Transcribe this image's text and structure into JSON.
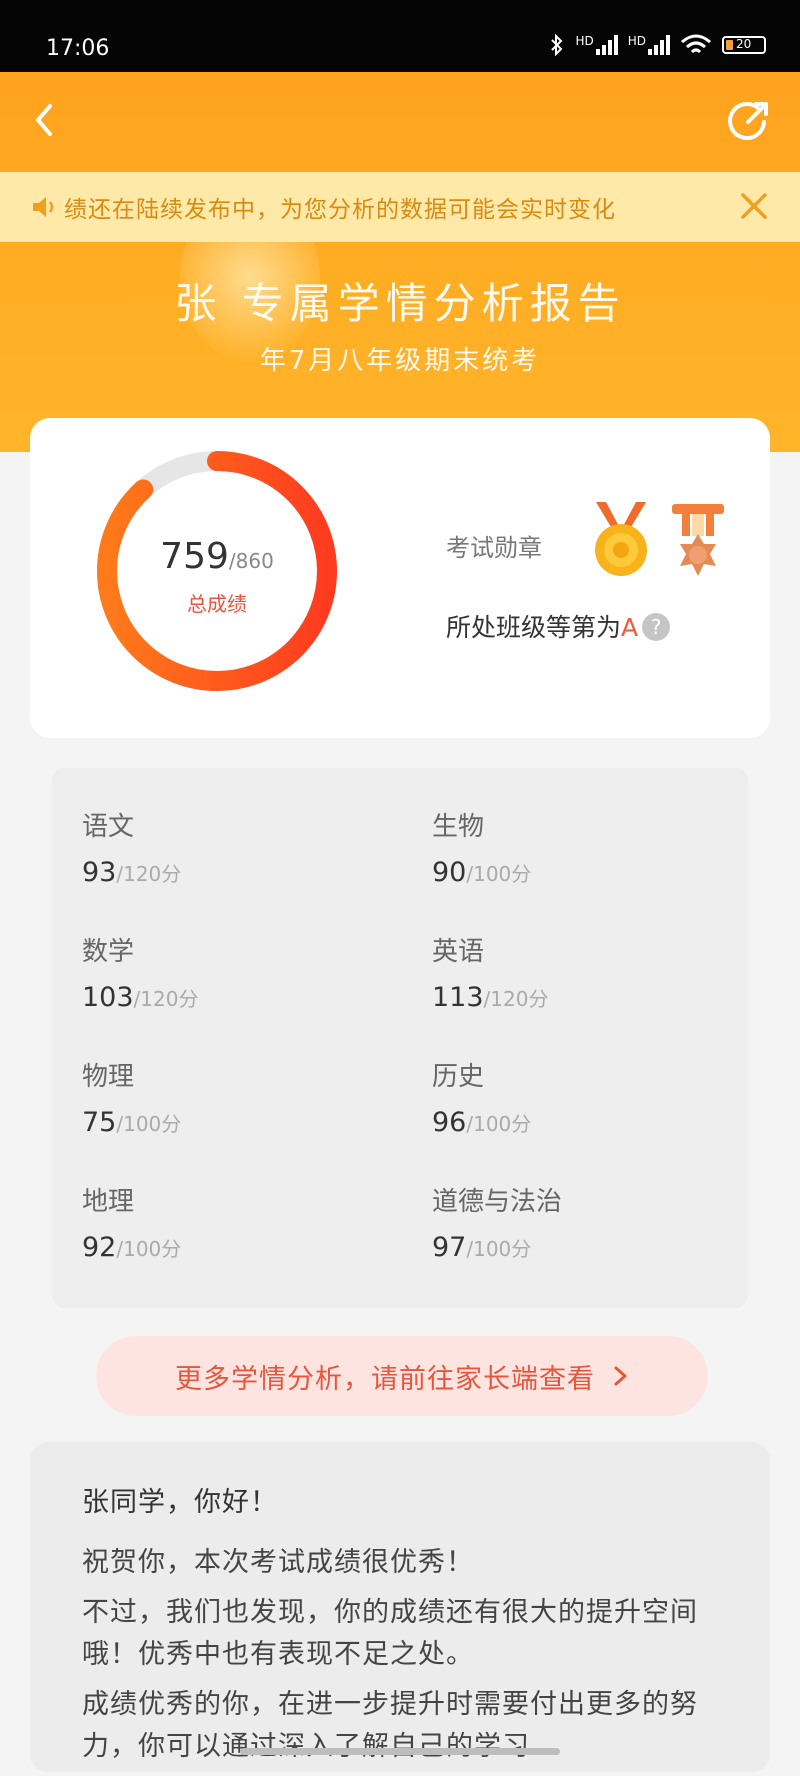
{
  "status_bar": {
    "time": "17:06",
    "network_1": "HD",
    "network_2": "HD",
    "battery": "20"
  },
  "header": {
    "notice": "绩还在陆续发布中，为您分析的数据可能会实时变化",
    "title": "张 专属学情分析报告",
    "subtitle": "年7月八年级期末统考"
  },
  "score": {
    "total": "759",
    "max": "/860",
    "label": "总成绩",
    "fraction": 0.8826,
    "ring_colors": [
      "#ff7a1a",
      "#ff3b1f"
    ],
    "track_color": "#e6e6e6"
  },
  "badges": {
    "label": "考试勋章",
    "rank_text": "所处班级等第为",
    "rank_grade": "A",
    "help": "?"
  },
  "subjects": [
    {
      "name": "语文",
      "score": "93",
      "max": "/120分"
    },
    {
      "name": "生物",
      "score": "90",
      "max": "/100分"
    },
    {
      "name": "数学",
      "score": "103",
      "max": "/120分"
    },
    {
      "name": "英语",
      "score": "113",
      "max": "/120分"
    },
    {
      "name": "物理",
      "score": "75",
      "max": "/100分"
    },
    {
      "name": "历史",
      "score": "96",
      "max": "/100分"
    },
    {
      "name": "地理",
      "score": "92",
      "max": "/100分"
    },
    {
      "name": "道德与法治",
      "score": "97",
      "max": "/100分"
    }
  ],
  "more_button": "更多学情分析，请前往家长端查看",
  "message": {
    "greeting": "张同学，你好！",
    "line1": "祝贺你，本次考试成绩很优秀！",
    "line2": "不过，我们也发现，你的成绩还有很大的提升空间哦！优秀中也有表现不足之处。",
    "line3": "成绩优秀的你，在进一步提升时需要付出更多的努力，你可以通过深入了解自己的学习"
  },
  "colors": {
    "accent": "#ffa21e",
    "notice_bg": "#ffe9a8",
    "notice_text": "#d98a12",
    "highlight": "#e5573c"
  }
}
